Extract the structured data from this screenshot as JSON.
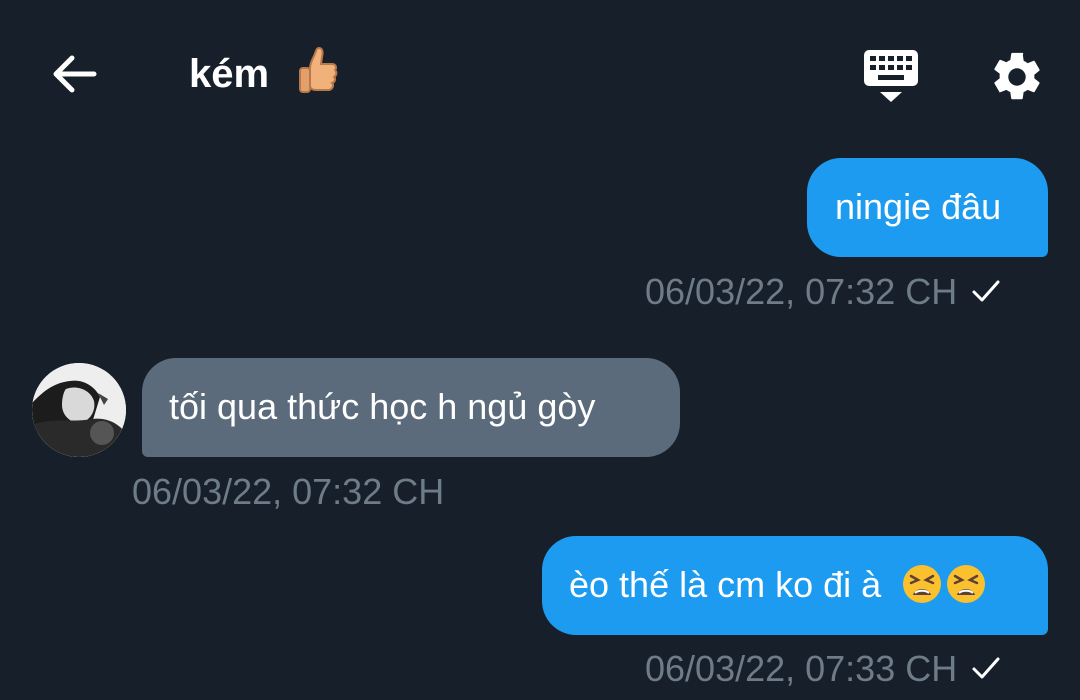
{
  "header": {
    "title": "kém",
    "title_emoji": "thumbs-up-icon"
  },
  "messages": [
    {
      "direction": "outgoing",
      "text": "ningie đâu",
      "timestamp": "06/03/22, 07:32 CH",
      "status": "sent"
    },
    {
      "direction": "incoming",
      "text": "tối qua thức học h ngủ gòy",
      "timestamp": "06/03/22, 07:32 CH"
    },
    {
      "direction": "outgoing",
      "text": "èo thế là cm ko đi à",
      "emojis": [
        "tired-face-emoji",
        "tired-face-emoji"
      ],
      "timestamp": "06/03/22, 07:33 CH",
      "status": "sent"
    }
  ],
  "colors": {
    "background": "#161f2a",
    "outgoing_bubble": "#1d9bf0",
    "incoming_bubble": "#5b6b7b",
    "timestamp": "#6e7b88"
  }
}
